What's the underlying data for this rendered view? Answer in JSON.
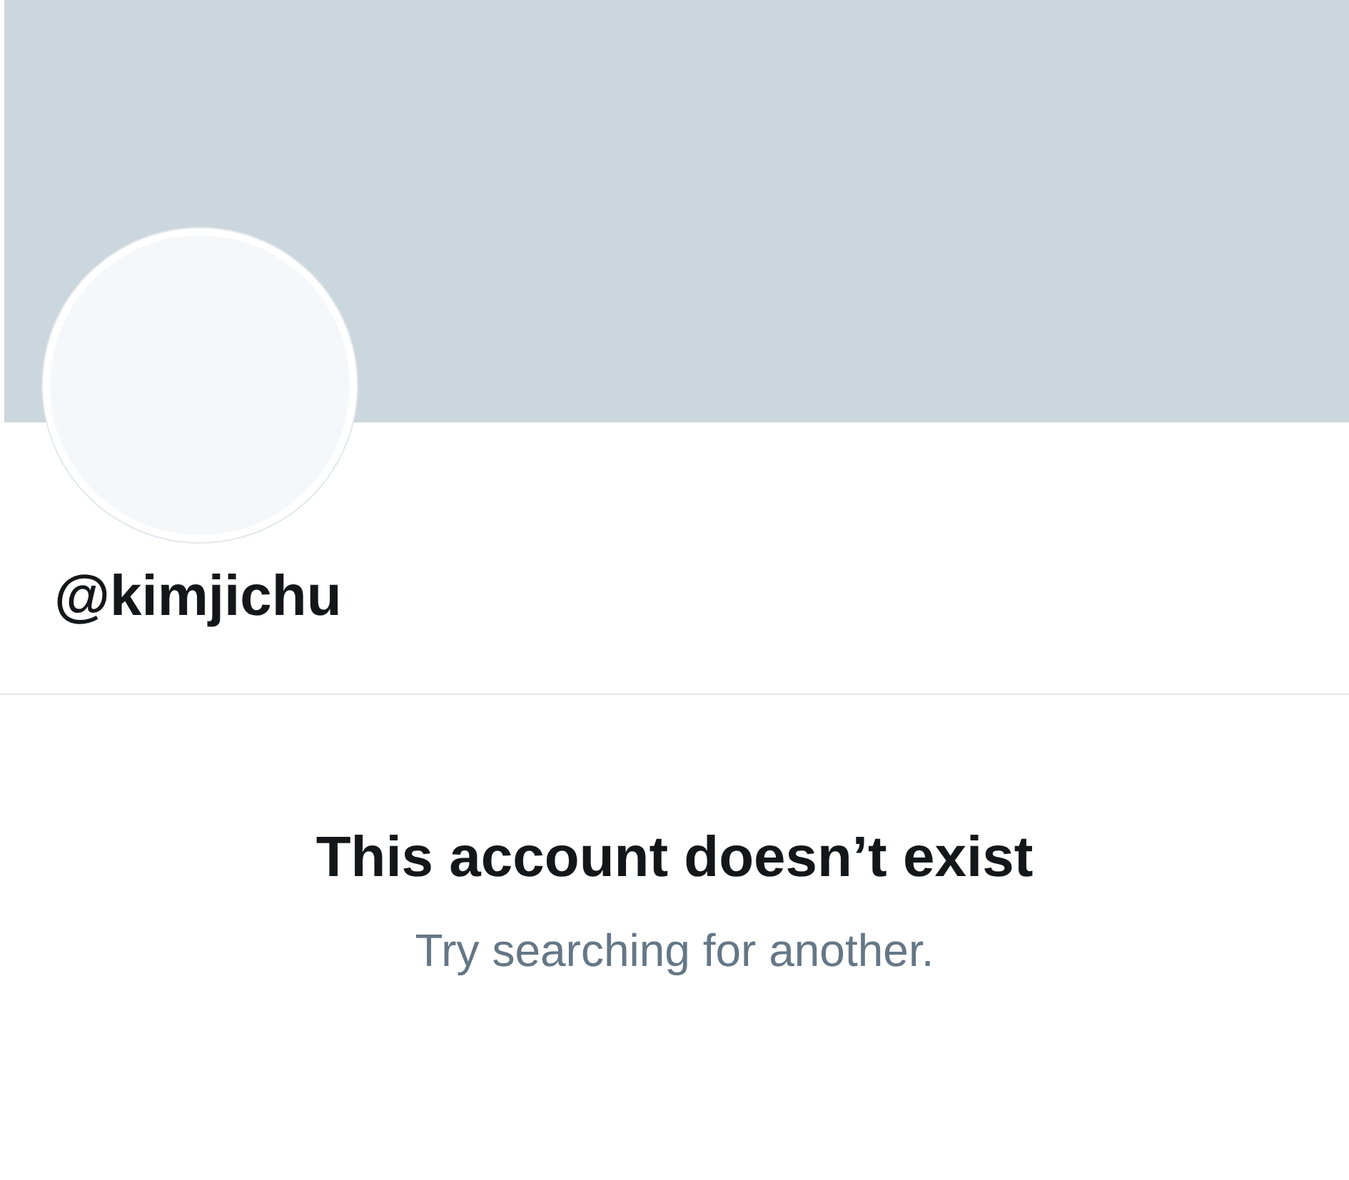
{
  "profile": {
    "handle": "@kimjichu"
  },
  "empty_state": {
    "title": "This account doesn’t exist",
    "message": "Try searching for another."
  }
}
